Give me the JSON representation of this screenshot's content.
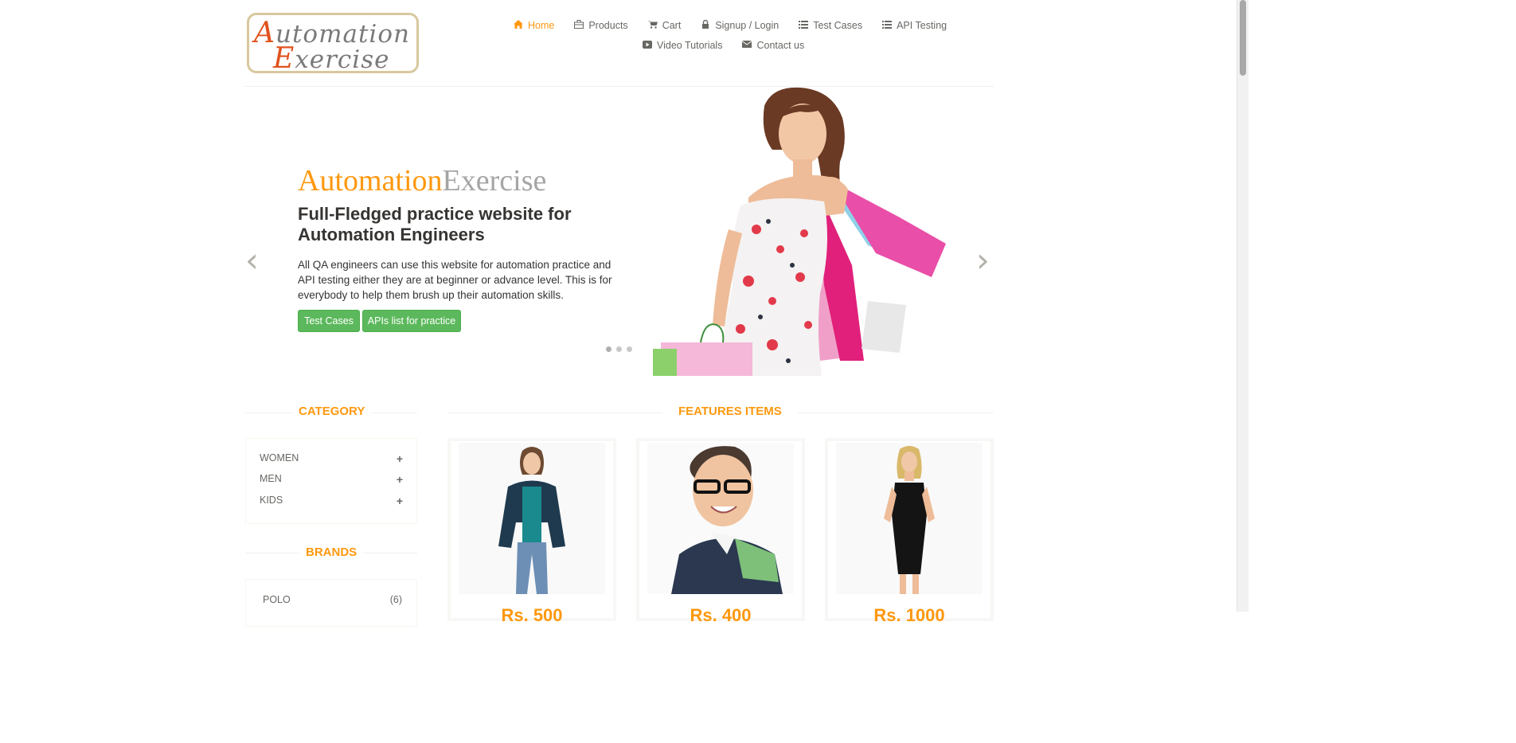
{
  "logo": {
    "line1_cap": "A",
    "line1_rest": "utomation",
    "line2_cap": "E",
    "line2_rest": "xercise"
  },
  "nav": {
    "row1": [
      {
        "label": "Home",
        "icon": "home-icon",
        "active": true
      },
      {
        "label": "Products",
        "icon": "briefcase-icon",
        "active": false
      },
      {
        "label": "Cart",
        "icon": "cart-icon",
        "active": false
      },
      {
        "label": "Signup / Login",
        "icon": "lock-icon",
        "active": false
      },
      {
        "label": "Test Cases",
        "icon": "list-icon",
        "active": false
      },
      {
        "label": "API Testing",
        "icon": "list-icon",
        "active": false
      }
    ],
    "row2": [
      {
        "label": "Video Tutorials",
        "icon": "youtube-play-icon",
        "active": false
      },
      {
        "label": "Contact us",
        "icon": "envelope-icon",
        "active": false
      }
    ]
  },
  "slider": {
    "heading_a": "Automation",
    "heading_b": "Exercise",
    "subheading": "Full-Fledged practice website for Automation Engineers",
    "description": "All QA engineers can use this website for automation practice and API testing either they are at beginner or advance level. This is for everybody to help them brush up their automation skills.",
    "btn_test_cases": "Test Cases",
    "btn_apis": "APIs list for practice",
    "prev_arrow": "‹",
    "next_arrow": "›"
  },
  "sidebar": {
    "category_title": "Category",
    "categories": [
      {
        "label": "WOMEN",
        "toggle": "+"
      },
      {
        "label": "MEN",
        "toggle": "+"
      },
      {
        "label": "KIDS",
        "toggle": "+"
      }
    ],
    "brands_title": "Brands",
    "brands": [
      {
        "label": "POLO",
        "count": "(6)"
      }
    ]
  },
  "features": {
    "title": "Features Items",
    "products": [
      {
        "price": "Rs. 500"
      },
      {
        "price": "Rs. 400"
      },
      {
        "price": "Rs. 1000"
      }
    ]
  },
  "colors": {
    "accent": "#fe980f",
    "button_green": "#5cb85c",
    "text": "#696763",
    "dark_text": "#363432"
  }
}
